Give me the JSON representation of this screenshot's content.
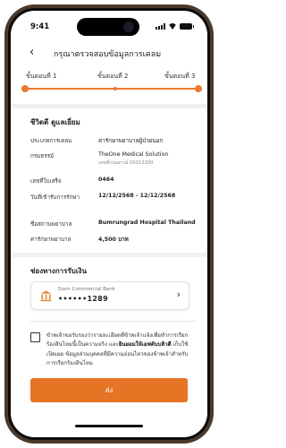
{
  "status_bar": {
    "time": "9:41"
  },
  "header": {
    "back_glyph": "‹",
    "title": "กรุณาตรวจสอบข้อมูลการเคลม"
  },
  "steps": [
    "ขั้นตอนที่ 1",
    "ขั้นตอนที่ 2",
    "ขั้นตอนที่ 3"
  ],
  "policy": {
    "section_title": "ชีวิตดี ดูแลเยี่ยม",
    "rows": [
      {
        "label": "ประเภทการเคลม",
        "value": "ค่ารักษาพยาบาลผู้ป่วยนอก"
      },
      {
        "label": "กรมธรรม์",
        "value": "TheOne Medical Solution",
        "sub": "เลขที่กรมธรรม์ 00213200"
      },
      {
        "label": "เลขที่ใบเสร็จ",
        "value": "0464"
      },
      {
        "label": "วันที่เข้ารับการรักษา",
        "value": "12/12/2568 - 12/12/2568"
      },
      {
        "label": "ชื่อสถานพยาบาล",
        "value": "Bumrungrad Hospital Thailand"
      },
      {
        "label": "ค่ารักษาพยาบาล",
        "value": "4,500 บาท"
      }
    ]
  },
  "payment": {
    "section_title": "ช่องทางการรับเงิน",
    "bank_name": "Siam Commercial Bank",
    "account_masked": "••••••1289",
    "chevron": "›"
  },
  "consent": {
    "part1": "ข้าพเจ้าขอรับรองว่ารายละเอียดที่ข้าพเจ้าแจ้งเพื่อทำการเรียกร้องสินไหมนี้เป็นความจริง และ",
    "part2": "ยินยอมให้เอฟดับบลิวดี",
    "part3": " เก็บใช้ เปิดเผย ข้อมูลส่วนบุคคลที่มีความอ่อนไหวของข้าพเจ้าสำหรับการเรียกร้องสินไหม"
  },
  "submit_label": "ส่ง",
  "colors": {
    "accent": "#e57425"
  }
}
